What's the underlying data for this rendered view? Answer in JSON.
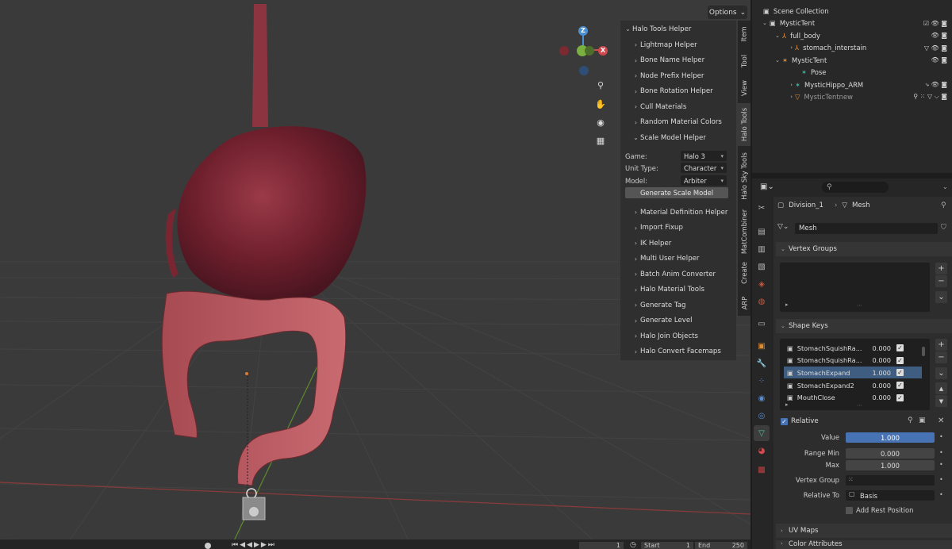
{
  "viewport": {
    "options_label": "Options",
    "panel_title": "Halo Tools Helper",
    "items_top": [
      "Lightmap Helper",
      "Bone Name Helper",
      "Node Prefix Helper",
      "Bone Rotation Helper",
      "Cull Materials",
      "Random Material Colors"
    ],
    "scale_helper": {
      "title": "Scale Model Helper",
      "game_label": "Game:",
      "game_value": "Halo 3",
      "unit_label": "Unit Type:",
      "unit_value": "Character",
      "model_label": "Model:",
      "model_value": "Arbiter",
      "button": "Generate Scale Model"
    },
    "items_bottom": [
      "Material Definition Helper",
      "Import Fixup",
      "IK Helper",
      "Multi User Helper",
      "Batch Anim Converter",
      "Halo Material Tools",
      "Generate Tag",
      "Generate Level",
      "Halo Join Objects",
      "Halo Convert Facemaps"
    ],
    "tabs": [
      "Item",
      "Tool",
      "View",
      "Halo Tools",
      "Halo Sky Tools",
      "MatCombiner",
      "Create",
      "ARP"
    ],
    "gizmo": {
      "z": "Z",
      "x": "X"
    }
  },
  "timeline": {
    "frame": "1",
    "start_label": "Start",
    "start": "1",
    "end_label": "End",
    "end": "250"
  },
  "outliner": {
    "rows": [
      {
        "label": "Scene Collection"
      },
      {
        "label": "MysticTent"
      },
      {
        "label": "full_body"
      },
      {
        "label": "stomach_interstain"
      },
      {
        "label": "MysticTent"
      },
      {
        "label": "Pose"
      },
      {
        "label": "MysticHippo_ARM"
      },
      {
        "label": "MysticTentnew"
      }
    ]
  },
  "properties": {
    "breadcrumb_object": "Division_1",
    "breadcrumb_data": "Mesh",
    "mesh_name": "Mesh",
    "vertex_groups_title": "Vertex Groups",
    "shape_keys_title": "Shape Keys",
    "shape_keys": [
      {
        "name": "StomachSquishRa...",
        "value": "0.000"
      },
      {
        "name": "StomachSquishRa...",
        "value": "0.000"
      },
      {
        "name": "StomachExpand",
        "value": "1.000"
      },
      {
        "name": "StomachExpand2",
        "value": "0.000"
      },
      {
        "name": "MouthClose",
        "value": "0.000"
      }
    ],
    "relative_label": "Relative",
    "value_label": "Value",
    "value": "1.000",
    "range_min_label": "Range Min",
    "range_min": "0.000",
    "max_label": "Max",
    "max": "1.000",
    "vertex_group_label": "Vertex Group",
    "relative_to_label": "Relative To",
    "relative_to": "Basis",
    "add_rest_label": "Add Rest Position",
    "uv_maps_title": "UV Maps",
    "color_attr_title": "Color Attributes"
  }
}
